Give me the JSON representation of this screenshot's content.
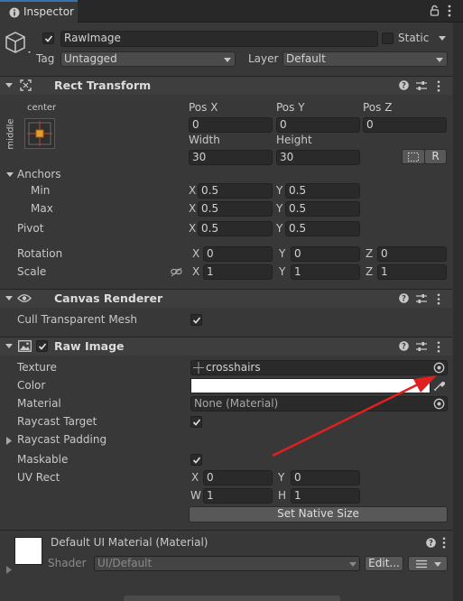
{
  "tab": {
    "title": "Inspector"
  },
  "object": {
    "name": "RawImage",
    "static_label": "Static",
    "tag_label": "Tag",
    "tag_value": "Untagged",
    "layer_label": "Layer",
    "layer_value": "Default",
    "active": true
  },
  "rect_transform": {
    "title": "Rect Transform",
    "anchor_preset_top": "center",
    "anchor_preset_side": "middle",
    "pos_x_label": "Pos X",
    "pos_y_label": "Pos Y",
    "pos_z_label": "Pos Z",
    "pos_x": "0",
    "pos_y": "0",
    "pos_z": "0",
    "width_label": "Width",
    "height_label": "Height",
    "width": "30",
    "height": "30",
    "r_button": "R",
    "anchors_label": "Anchors",
    "min_label": "Min",
    "max_label": "Max",
    "min_x": "0.5",
    "min_y": "0.5",
    "max_x": "0.5",
    "max_y": "0.5",
    "pivot_label": "Pivot",
    "pivot_x": "0.5",
    "pivot_y": "0.5",
    "rotation_label": "Rotation",
    "rot_x": "0",
    "rot_y": "0",
    "rot_z": "0",
    "scale_label": "Scale",
    "scale_x": "1",
    "scale_y": "1",
    "scale_z": "1",
    "x": "X",
    "y": "Y",
    "z": "Z"
  },
  "canvas_renderer": {
    "title": "Canvas Renderer",
    "cull_label": "Cull Transparent Mesh",
    "cull_checked": true
  },
  "raw_image": {
    "title": "Raw Image",
    "enabled": true,
    "texture_label": "Texture",
    "texture_value": "crosshairs",
    "color_label": "Color",
    "color_value": "#ffffff",
    "material_label": "Material",
    "material_value": "None (Material)",
    "raycast_target_label": "Raycast Target",
    "raycast_target_checked": true,
    "raycast_padding_label": "Raycast Padding",
    "maskable_label": "Maskable",
    "maskable_checked": true,
    "uv_rect_label": "UV Rect",
    "uv_x": "0",
    "uv_y": "0",
    "uv_w": "1",
    "uv_h": "1",
    "x": "X",
    "y": "Y",
    "w": "W",
    "h": "H",
    "set_native_size": "Set Native Size"
  },
  "material_preview": {
    "name": "Default UI Material (Material)",
    "shader_label": "Shader",
    "shader_value": "UI/Default",
    "edit_button": "Edit..."
  },
  "colors": {
    "annotation_arrow": "#e02020",
    "panel_bg": "#383838",
    "header_bg": "#3e3e3e"
  }
}
